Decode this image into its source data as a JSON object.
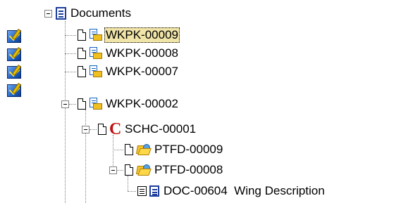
{
  "tree": {
    "root": {
      "label": "Documents",
      "icon": "document-icon"
    },
    "workpackages": [
      {
        "label": "WKPK-00009",
        "selected": true,
        "expanded": false,
        "flag_icon": "checkout-flag-icon"
      },
      {
        "label": "WKPK-00008",
        "selected": false,
        "expanded": false,
        "flag_icon": "checkout-flag-icon"
      },
      {
        "label": "WKPK-00007",
        "selected": false,
        "expanded": false,
        "flag_icon": "checkout-flag-icon"
      },
      {
        "label": "WKPK-00002",
        "selected": false,
        "expanded": true,
        "flag_icon": "checkout-flag-icon"
      }
    ],
    "schedule": {
      "label": "SCHC-00001",
      "icon": "c-icon",
      "icon_color": "#c01010"
    },
    "folders": [
      {
        "label": "PTFD-00009",
        "expanded": false
      },
      {
        "label": "PTFD-00008",
        "expanded": true
      }
    ],
    "document": {
      "label": "DOC-00604  Wing Description"
    }
  },
  "colors": {
    "selection_bg": "#f0e4a8",
    "connector": "#808080",
    "doc_blue": "#1c3e9c",
    "folder_yellow": "#f4c430"
  }
}
